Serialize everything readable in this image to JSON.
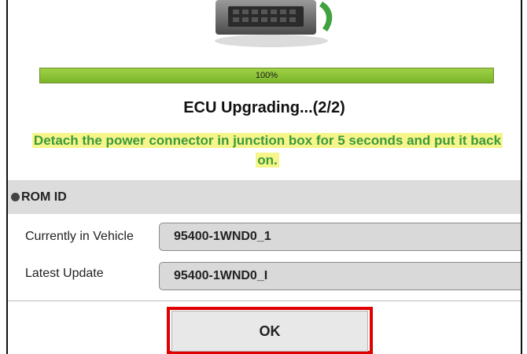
{
  "progress": {
    "percent_label": "100%",
    "fraction": 1.0
  },
  "status_title": "ECU Upgrading...(2/2)",
  "instruction": {
    "line1": "Detach the power connector in junction box for 5 seconds and put it back",
    "line2": "on."
  },
  "rom_section": {
    "header": "ROM ID",
    "rows": [
      {
        "label": "Currently in Vehicle",
        "value": "95400-1WND0_1"
      },
      {
        "label": "Latest Update",
        "value": "95400-1WND0_I"
      }
    ]
  },
  "ok_button": {
    "label": "OK"
  },
  "colors": {
    "progress_fill": "#8cc43a",
    "instruction_text": "#3c9a3c",
    "instruction_highlight": "#f6f58a",
    "annotation_border": "#e00000"
  },
  "icons": {
    "ecu_graphic": "ecu-module-icon"
  }
}
